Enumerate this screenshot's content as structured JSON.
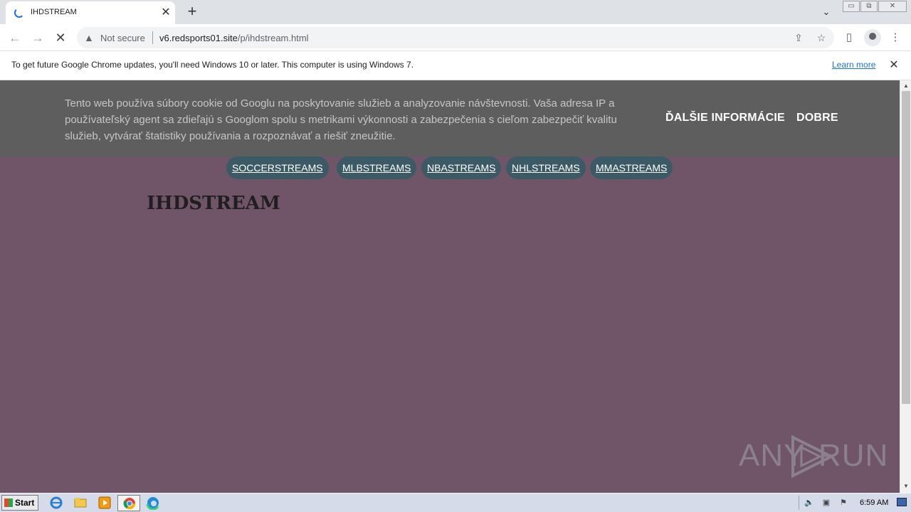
{
  "browser": {
    "tab_title": "IHDSTREAM",
    "tab_close": "✕",
    "new_tab": "+",
    "security_label": "Not secure",
    "url_host": "v6.redsports01.site",
    "url_path": "/p/ihdstream.html",
    "window_controls": {
      "minimize": "▭",
      "restore": "⧉",
      "close": "✕"
    }
  },
  "infobar": {
    "message": "To get future Google Chrome updates, you'll need Windows 10 or later. This computer is using Windows 7.",
    "link": "Learn more",
    "close": "✕"
  },
  "cookie_banner": {
    "text": "Tento web používa súbory cookie od Googlu na poskytovanie služieb a analyzovanie návštevnosti. Vaša adresa IP a používateľský agent sa zdieľajú s Googlom spolu s metrikami výkonnosti a zabezpečenia s cieľom zabezpečiť kvalitu služieb, vytvárať štatistiky používania a rozpoznávať a riešiť zneužitie.",
    "more_info": "ĎALŠIE INFORMÁCIE",
    "ok": "DOBRE"
  },
  "nav": {
    "items": [
      "SOCCERSTREAMS",
      "MLBSTREAMS",
      "NBASTREAMS",
      "NHLSTREAMS",
      "MMASTREAMS"
    ]
  },
  "page": {
    "title": "IHDSTREAM",
    "background_color": "#705568",
    "pill_color": "#3c5a66"
  },
  "watermark": {
    "left": "ANY",
    "right": "RUN"
  },
  "taskbar": {
    "start_label": "Start",
    "clock": "6:59 AM"
  },
  "icons": [
    "back-icon",
    "forward-icon",
    "stop-icon",
    "warning-icon",
    "share-icon",
    "star-icon",
    "side-panel-icon",
    "profile-icon",
    "menu-icon"
  ]
}
